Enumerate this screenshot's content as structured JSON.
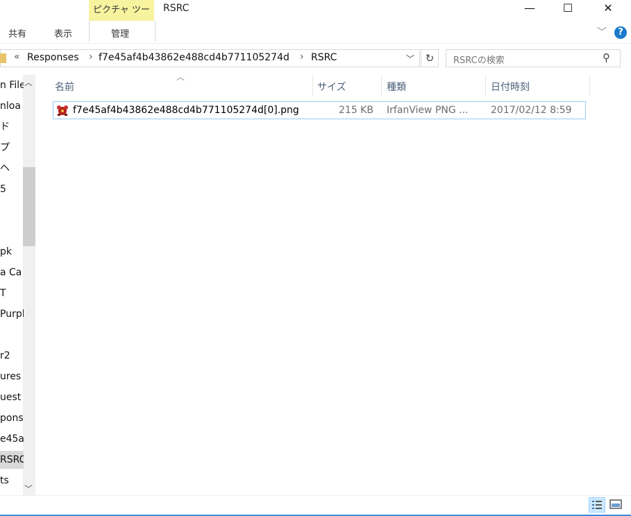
{
  "window": {
    "title": "RSRC"
  },
  "ribbon": {
    "context_tab": "ピクチャ ツール",
    "tabs": [
      "共有",
      "表示",
      "管理"
    ],
    "help": "?"
  },
  "controls": {
    "minimize": "—",
    "maximize": "☐",
    "close": "✕"
  },
  "address": {
    "prefix": "«",
    "crumbs": [
      "Responses",
      "f7e45af4b43862e488cd4b771105274d",
      "RSRC"
    ],
    "sep": "›"
  },
  "search": {
    "placeholder": "RSRCの検索"
  },
  "nav": {
    "items": [
      "n File",
      "nloa",
      "ド",
      "プ",
      "ヘ",
      "5",
      "",
      "",
      "pk",
      "a Ca",
      "T",
      "Purpl",
      "",
      "r2",
      "ures",
      "uest",
      "pons",
      "e45a",
      "RSRC",
      "ts"
    ],
    "selected_index": 18
  },
  "columns": {
    "name": "名前",
    "size": "サイズ",
    "type": "種類",
    "date": "日付時刻"
  },
  "files": [
    {
      "name": "f7e45af4b43862e488cd4b771105274d[0].png",
      "size": "215 KB",
      "type": "IrfanView PNG ...",
      "date": "2017/02/12 8:59"
    }
  ],
  "colors": {
    "accent": "#3c8ad8",
    "context_tab": "#f7f39f",
    "selection_border": "#99c9ef"
  }
}
